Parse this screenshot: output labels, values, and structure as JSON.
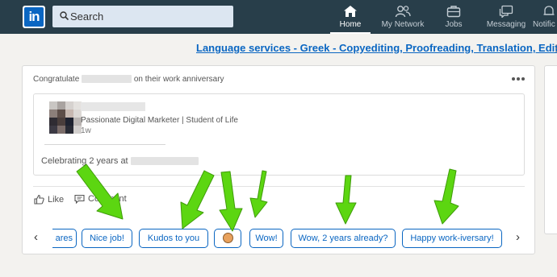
{
  "topbar": {
    "logo_text": "in",
    "search_placeholder": "Search",
    "nav": [
      {
        "label": "Home",
        "icon": "home-icon",
        "active": true
      },
      {
        "label": "My Network",
        "icon": "my-network-icon",
        "active": false
      },
      {
        "label": "Jobs",
        "icon": "jobs-icon",
        "active": false
      },
      {
        "label": "Messaging",
        "icon": "messaging-icon",
        "active": false
      },
      {
        "label": "Notific",
        "icon": "notifications-icon",
        "active": false
      }
    ]
  },
  "ad": {
    "text": "Language services - Greek - Copyediting, Proofreading, Translation, Editing"
  },
  "card": {
    "header_prefix": "Congratulate",
    "header_suffix": "on their work anniversary",
    "headline": "Passionate Digital Marketer | Student of Life",
    "posted": "1w",
    "celebrating": "Celebrating 2 years at",
    "actions": {
      "like": "Like",
      "comment": "Comment"
    },
    "quick_replies": [
      {
        "label": "ares",
        "partial": true
      },
      {
        "label": "Nice job!"
      },
      {
        "label": "Kudos to you"
      },
      {
        "label": "",
        "emoji": "applause-emoji-icon"
      },
      {
        "label": "Wow!"
      },
      {
        "label": "Wow, 2 years already?"
      },
      {
        "label": "Happy work-iversary!"
      }
    ],
    "prev_arrow": "‹",
    "next_arrow": "›"
  },
  "colors": {
    "nav_bg": "#283e4a",
    "brand_blue": "#0a66c2",
    "annotation_green": "#5cd611"
  }
}
